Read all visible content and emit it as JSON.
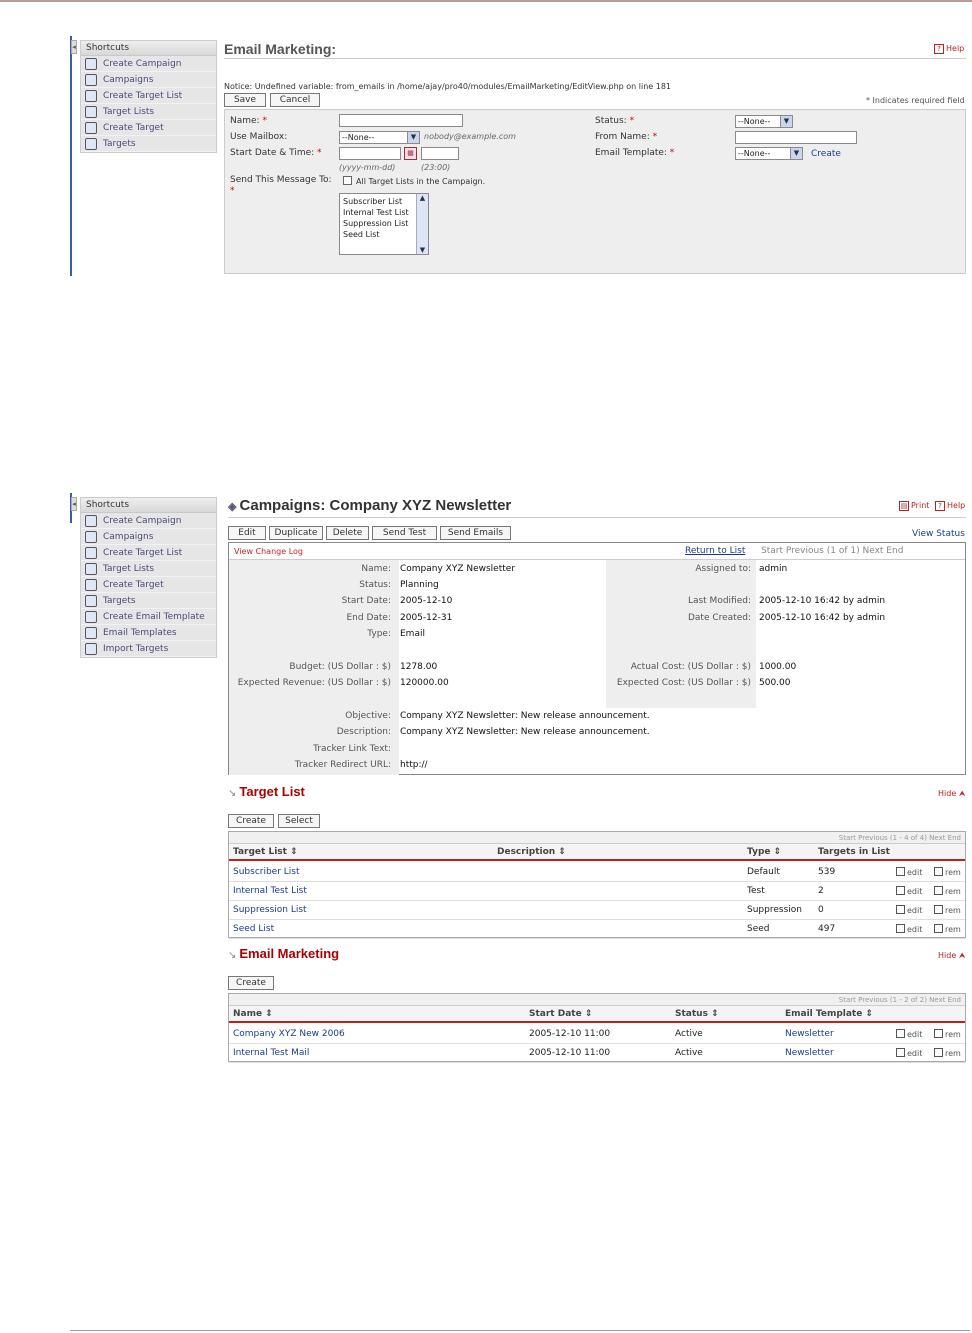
{
  "shortcuts_title": "Shortcuts",
  "edit_view": {
    "shortcuts": [
      {
        "label": "Create Campaign",
        "icon": "create-campaign-icon"
      },
      {
        "label": "Campaigns",
        "icon": "campaigns-icon"
      },
      {
        "label": "Create Target List",
        "icon": "create-target-list-icon"
      },
      {
        "label": "Target Lists",
        "icon": "target-lists-icon"
      },
      {
        "label": "Create Target",
        "icon": "create-target-icon"
      },
      {
        "label": "Targets",
        "icon": "targets-icon"
      }
    ],
    "title": "Email Marketing:",
    "help": "Help",
    "notice": "Notice: Undefined variable: from_emails in /home/ajay/pro40/modules/EmailMarketing/EditView.php on line 181",
    "save": "Save",
    "cancel": "Cancel",
    "required_note": "* Indicates required field",
    "name_label": "Name:",
    "use_mailbox_label": "Use Mailbox:",
    "mailbox_value": "--None--",
    "mailbox_hint": "nobody@example.com",
    "start_label": "Start Date & Time:",
    "date_hint": "(yyyy-mm-dd)",
    "time_hint": "(23:00)",
    "send_label": "Send This Message To:",
    "all_lists": "All Target Lists in the Campaign.",
    "list_options": [
      "Subscriber List",
      "Internal Test List",
      "Suppression List",
      "Seed List"
    ],
    "status_label": "Status:",
    "status_value": "--None--",
    "from_name_label": "From Name:",
    "template_label": "Email Template:",
    "template_value": "--None--",
    "create_link": "Create"
  },
  "detail_view": {
    "shortcuts": [
      {
        "label": "Create Campaign",
        "icon": "create-campaign-icon"
      },
      {
        "label": "Campaigns",
        "icon": "campaigns-icon"
      },
      {
        "label": "Create Target List",
        "icon": "create-target-list-icon"
      },
      {
        "label": "Target Lists",
        "icon": "target-lists-icon"
      },
      {
        "label": "Create Target",
        "icon": "create-target-icon"
      },
      {
        "label": "Targets",
        "icon": "targets-icon"
      },
      {
        "label": "Create Email Template",
        "icon": "create-email-template-icon"
      },
      {
        "label": "Email Templates",
        "icon": "email-templates-icon"
      },
      {
        "label": "Import Targets",
        "icon": "import-targets-icon"
      }
    ],
    "title": "Campaigns: Company XYZ Newsletter",
    "print": "Print",
    "help": "Help",
    "buttons": {
      "edit": "Edit",
      "duplicate": "Duplicate",
      "delete": "Delete",
      "send_test": "Send Test",
      "send_emails": "Send Emails"
    },
    "view_status": "View Status",
    "view_change_log": "View Change Log",
    "return_to_list": "Return to List",
    "nav": "Start  Previous  (1 of 1)  Next  End",
    "fields": {
      "name_l": "Name:",
      "name_v": "Company XYZ Newsletter",
      "assigned_l": "Assigned to:",
      "assigned_v": "admin",
      "status_l": "Status:",
      "status_v": "Planning",
      "start_l": "Start Date:",
      "start_v": "2005-12-10",
      "modified_l": "Last Modified:",
      "modified_v": "2005-12-10 16:42 by admin",
      "end_l": "End Date:",
      "end_v": "2005-12-31",
      "created_l": "Date Created:",
      "created_v": "2005-12-10 16:42 by admin",
      "type_l": "Type:",
      "type_v": "Email",
      "budget_l": "Budget: (US Dollar : $)",
      "budget_v": "1278.00",
      "actual_l": "Actual Cost: (US Dollar : $)",
      "actual_v": "1000.00",
      "revenue_l": "Expected Revenue: (US Dollar : $)",
      "revenue_v": "120000.00",
      "expected_l": "Expected Cost: (US Dollar : $)",
      "expected_v": "500.00",
      "objective_l": "Objective:",
      "objective_v": "Company XYZ Newsletter: New release announcement.",
      "description_l": "Description:",
      "description_v": "Company XYZ Newsletter: New release announcement.",
      "tracker_text_l": "Tracker Link Text:",
      "tracker_text_v": "",
      "tracker_url_l": "Tracker Redirect URL:",
      "tracker_url_v": "http://"
    },
    "target_list": {
      "title": "Target List",
      "hide": "Hide",
      "create": "Create",
      "select": "Select",
      "nav": "Start  Previous  (1 - 4 of 4)  Next  End",
      "columns": [
        "Target List",
        "Description",
        "Type",
        "Targets in List"
      ],
      "rows": [
        {
          "name": "Subscriber List",
          "description": "",
          "type": "Default",
          "count": "539"
        },
        {
          "name": "Internal Test List",
          "description": "",
          "type": "Test",
          "count": "2"
        },
        {
          "name": "Suppression List",
          "description": "",
          "type": "Suppression",
          "count": "0"
        },
        {
          "name": "Seed List",
          "description": "",
          "type": "Seed",
          "count": "497"
        }
      ],
      "edit": "edit",
      "rem": "rem"
    },
    "email_marketing": {
      "title": "Email Marketing",
      "hide": "Hide",
      "create": "Create",
      "nav": "Start  Previous  (1 - 2 of 2)  Next  End",
      "columns": [
        "Name",
        "Start Date",
        "Status",
        "Email Template"
      ],
      "rows": [
        {
          "name": "Company XYZ New 2006",
          "start": "2005-12-10 11:00",
          "status": "Active",
          "template": "Newsletter"
        },
        {
          "name": "Internal Test Mail",
          "start": "2005-12-10 11:00",
          "status": "Active",
          "template": "Newsletter"
        }
      ],
      "edit": "edit",
      "rem": "rem"
    }
  }
}
